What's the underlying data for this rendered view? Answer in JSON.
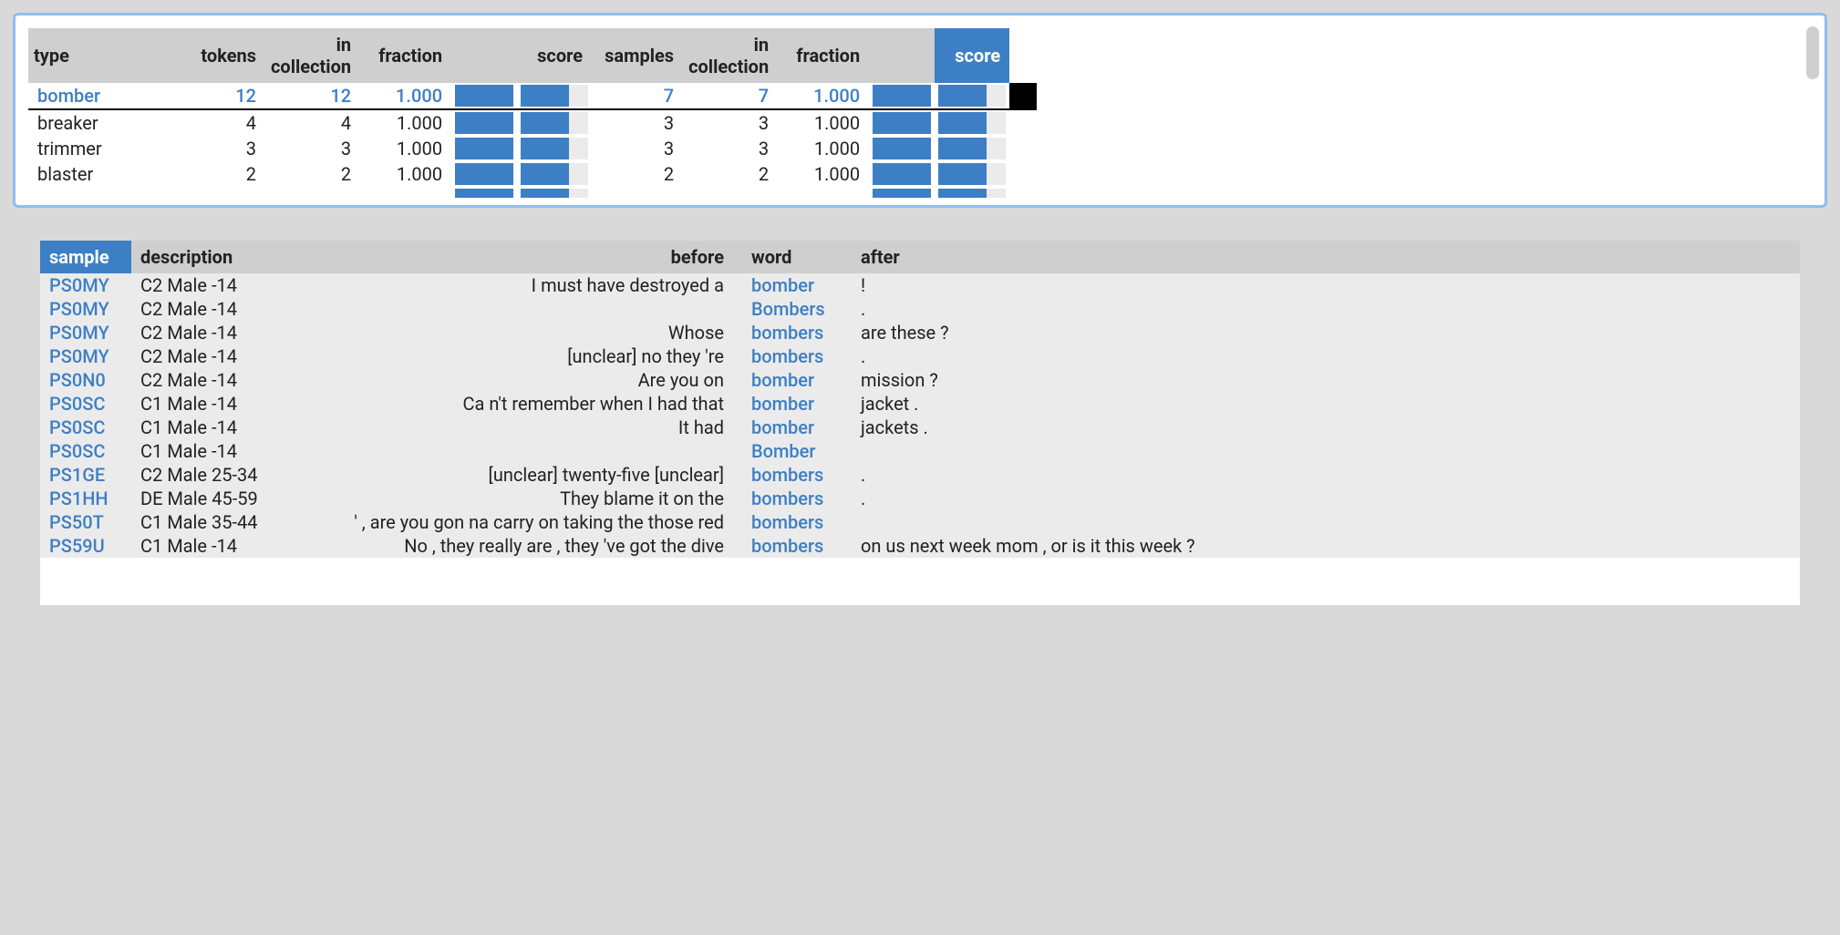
{
  "colors": {
    "accent": "#3d7fc4",
    "track": "#ebebeb",
    "header": "#cfcfcf"
  },
  "top": {
    "headers": {
      "type": "type",
      "tokens": "tokens",
      "in_collection_1": "in collection",
      "fraction_1": "fraction",
      "score_1": "score",
      "samples": "samples",
      "in_collection_2": "in collection",
      "fraction_2": "fraction",
      "score_2": "score"
    },
    "rows": [
      {
        "type": "bomber",
        "tokens": 12,
        "in_coll_1": 12,
        "frac_1": "1.000",
        "bar_1": 1.0,
        "score_1": 0.72,
        "samples": 7,
        "in_coll_2": 7,
        "frac_2": "1.000",
        "bar_2": 1.0,
        "score_2": 0.72,
        "selected": true,
        "mark": true
      },
      {
        "type": "breaker",
        "tokens": 4,
        "in_coll_1": 4,
        "frac_1": "1.000",
        "bar_1": 1.0,
        "score_1": 0.72,
        "samples": 3,
        "in_coll_2": 3,
        "frac_2": "1.000",
        "bar_2": 1.0,
        "score_2": 0.72,
        "selected": false,
        "mark": false
      },
      {
        "type": "trimmer",
        "tokens": 3,
        "in_coll_1": 3,
        "frac_1": "1.000",
        "bar_1": 1.0,
        "score_1": 0.72,
        "samples": 3,
        "in_coll_2": 3,
        "frac_2": "1.000",
        "bar_2": 1.0,
        "score_2": 0.72,
        "selected": false,
        "mark": false
      },
      {
        "type": "blaster",
        "tokens": 2,
        "in_coll_1": 2,
        "frac_1": "1.000",
        "bar_1": 1.0,
        "score_1": 0.72,
        "samples": 2,
        "in_coll_2": 2,
        "frac_2": "1.000",
        "bar_2": 1.0,
        "score_2": 0.72,
        "selected": false,
        "mark": false
      }
    ],
    "cutoff": {
      "bar_1": 1.0,
      "score_1": 0.72,
      "bar_2": 1.0,
      "score_2": 0.72
    }
  },
  "bottom": {
    "headers": {
      "sample": "sample",
      "description": "description",
      "before": "before",
      "word": "word",
      "after": "after"
    },
    "rows": [
      {
        "sample": "PS0MY",
        "desc": "C2 Male -14",
        "before": "I must have destroyed a",
        "word": "bomber",
        "after": "!"
      },
      {
        "sample": "PS0MY",
        "desc": "C2 Male -14",
        "before": "",
        "word": "Bombers",
        "after": "."
      },
      {
        "sample": "PS0MY",
        "desc": "C2 Male -14",
        "before": "Whose",
        "word": "bombers",
        "after": "are these ?"
      },
      {
        "sample": "PS0MY",
        "desc": "C2 Male -14",
        "before": "[unclear] no they 're",
        "word": "bombers",
        "after": "."
      },
      {
        "sample": "PS0N0",
        "desc": "C2 Male -14",
        "before": "Are you on",
        "word": "bomber",
        "after": "mission ?"
      },
      {
        "sample": "PS0SC",
        "desc": "C1 Male -14",
        "before": "Ca n't remember when I had that",
        "word": "bomber",
        "after": "jacket ."
      },
      {
        "sample": "PS0SC",
        "desc": "C1 Male -14",
        "before": "It had",
        "word": "bomber",
        "after": "jackets ."
      },
      {
        "sample": "PS0SC",
        "desc": "C1 Male -14",
        "before": "",
        "word": "Bomber",
        "after": ""
      },
      {
        "sample": "PS1GE",
        "desc": "C2 Male 25-34",
        "before": "[unclear] twenty-five [unclear]",
        "word": "bombers",
        "after": "."
      },
      {
        "sample": "PS1HH",
        "desc": "DE Male 45-59",
        "before": "They blame it on the",
        "word": "bombers",
        "after": "."
      },
      {
        "sample": "PS50T",
        "desc": "C1 Male 35-44",
        "before": "' , are you gon na carry on taking the those red",
        "word": "bombers",
        "after": ""
      },
      {
        "sample": "PS59U",
        "desc": "C1 Male -14",
        "before": "No , they really are , they 've got the dive",
        "word": "bombers",
        "after": "on us next week mom , or is it this week ?"
      }
    ]
  }
}
